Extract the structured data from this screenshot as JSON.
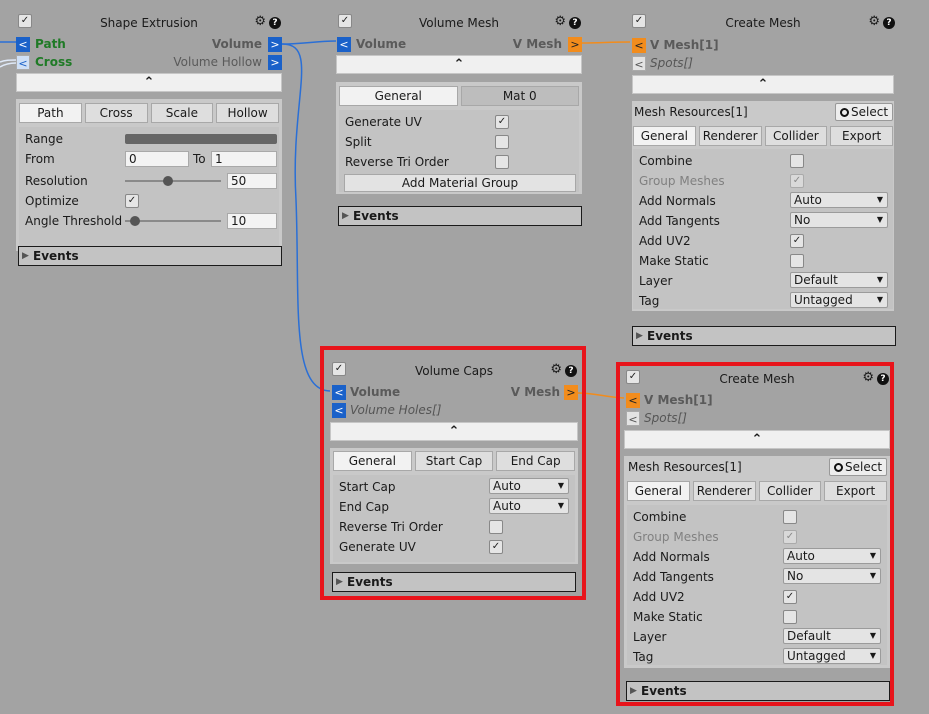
{
  "shape_extrusion": {
    "title": "Shape Extrusion",
    "inputs": [
      {
        "label": "Path",
        "color": "#1f7a26"
      },
      {
        "label": "Cross",
        "color": "#1f7a26"
      }
    ],
    "outputs": [
      "Volume",
      "Volume Hollow"
    ],
    "tabs": [
      "Path",
      "Cross",
      "Scale",
      "Hollow"
    ],
    "rows": {
      "range_label": "Range",
      "from_label": "From",
      "from_value": "0",
      "to_label": "To",
      "to_value": "1",
      "resolution_label": "Resolution",
      "resolution_value": "50",
      "resolution_fraction": 0.45,
      "optimize_label": "Optimize",
      "angle_label": "Angle Threshold",
      "angle_value": "10",
      "angle_fraction": 0.1
    },
    "events": "Events"
  },
  "volume_mesh": {
    "title": "Volume Mesh",
    "input": "Volume",
    "output": "V Mesh",
    "tabs": [
      "General",
      "Mat 0"
    ],
    "rows": [
      "Generate UV",
      "Split",
      "Reverse Tri Order"
    ],
    "add_material_group": "Add Material Group",
    "events": "Events"
  },
  "create_mesh_1": {
    "title": "Create Mesh",
    "inputs": [
      "V Mesh[1]",
      "Spots[]"
    ],
    "resources_label": "Mesh Resources[1]",
    "select_label": "Select",
    "tabs": [
      "General",
      "Renderer",
      "Collider",
      "Export"
    ],
    "rows": {
      "combine": "Combine",
      "group_meshes": "Group Meshes",
      "add_normals": "Add Normals",
      "add_normals_value": "Auto",
      "add_tangents": "Add Tangents",
      "add_tangents_value": "No",
      "add_uv2": "Add UV2",
      "make_static": "Make Static",
      "layer": "Layer",
      "layer_value": "Default",
      "tag": "Tag",
      "tag_value": "Untagged"
    },
    "events": "Events"
  },
  "volume_caps": {
    "title": "Volume Caps",
    "inputs": [
      "Volume",
      "Volume Holes[]"
    ],
    "output": "V Mesh",
    "tabs": [
      "General",
      "Start Cap",
      "End Cap"
    ],
    "rows": {
      "start_cap": "Start Cap",
      "start_cap_value": "Auto",
      "end_cap": "End Cap",
      "end_cap_value": "Auto",
      "reverse_tri_order": "Reverse Tri Order",
      "generate_uv": "Generate UV"
    },
    "events": "Events"
  },
  "create_mesh_2": {
    "title": "Create Mesh",
    "inputs": [
      "V Mesh[1]",
      "Spots[]"
    ],
    "resources_label": "Mesh Resources[1]",
    "select_label": "Select",
    "tabs": [
      "General",
      "Renderer",
      "Collider",
      "Export"
    ],
    "rows": {
      "combine": "Combine",
      "group_meshes": "Group Meshes",
      "add_normals": "Add Normals",
      "add_normals_value": "Auto",
      "add_tangents": "Add Tangents",
      "add_tangents_value": "No",
      "add_uv2": "Add UV2",
      "make_static": "Make Static",
      "layer": "Layer",
      "layer_value": "Default",
      "tag": "Tag",
      "tag_value": "Untagged"
    },
    "events": "Events"
  },
  "glyphs": {
    "check": "✓",
    "in": "<",
    "out": ">",
    "collapse": "⌃",
    "gear": "⚙",
    "help": "?",
    "triangle": "▶",
    "arrow": "▼"
  },
  "colors": {
    "background": "#a3a3a3",
    "port_blue": "#1a61c9",
    "port_orange": "#f28c1c",
    "highlight": "#e8141b",
    "wire_blue": "#2a6fd6",
    "wire_orange": "#f28c1c"
  }
}
